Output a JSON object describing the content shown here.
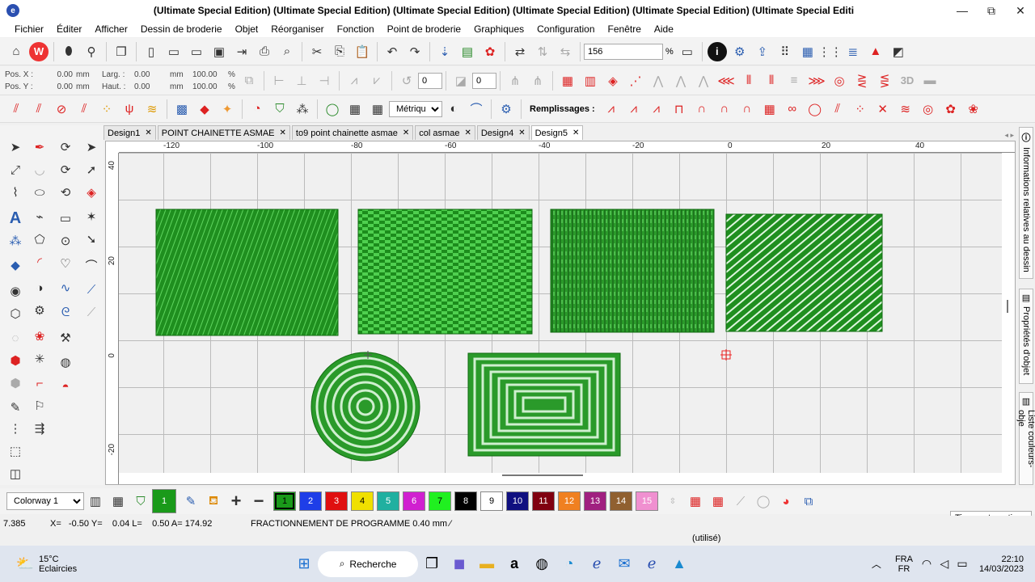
{
  "window": {
    "title": "(Ultimate Special Edition) (Ultimate Special Edition) (Ultimate Special Edition) (Ultimate Special Edition) (Ultimate Special Edition) (Ultimate Special Editi",
    "minimize": "—",
    "restore": "⧉",
    "close": "✕"
  },
  "menu": [
    "Fichier",
    "Éditer",
    "Afficher",
    "Dessin de broderie",
    "Objet",
    "Réorganiser",
    "Fonction",
    "Point de broderie",
    "Graphiques",
    "Configuration",
    "Fenêtre",
    "Aide"
  ],
  "toolbar1": {
    "zoom_value": "156",
    "zoom_unit": "%"
  },
  "toolbar2": {
    "pos_x_label": "Pos. X :",
    "pos_x": "0.00",
    "pos_y_label": "Pos. Y :",
    "pos_y": "0.00",
    "unit": "mm",
    "larg_label": "Larg. :",
    "larg": "0.00",
    "haut_label": "Haut. :",
    "haut": "0.00",
    "pct_w": "100.00",
    "pct_h": "100.00",
    "pct": "%",
    "rotation": "0",
    "slant": "0"
  },
  "toolbar3": {
    "units_select": "Métrique",
    "fills_label": "Remplissages :"
  },
  "tabs": [
    {
      "label": "Design1"
    },
    {
      "label": "POINT CHAINETTE ASMAE"
    },
    {
      "label": "to9 point chainette asmae"
    },
    {
      "label": "col asmae"
    },
    {
      "label": "Design4"
    },
    {
      "label": "Design5",
      "active": true
    }
  ],
  "ruler_h": [
    "-120",
    "-100",
    "-80",
    "-60",
    "-40",
    "-20",
    "0",
    "20",
    "40"
  ],
  "ruler_v": [
    "40",
    "20",
    "0",
    "-20"
  ],
  "right_panel": [
    "Informations relatives au dessin",
    "Propriétés d'objet",
    "Liste couleurs-obje"
  ],
  "palette": {
    "colorway": "Colorway 1",
    "current": "1",
    "swatches": [
      {
        "n": "1",
        "c": "#1a9a1a"
      },
      {
        "n": "2",
        "c": "#1e3ee8"
      },
      {
        "n": "3",
        "c": "#e01010"
      },
      {
        "n": "4",
        "c": "#f0e000"
      },
      {
        "n": "5",
        "c": "#20b0a0"
      },
      {
        "n": "6",
        "c": "#d020d0"
      },
      {
        "n": "7",
        "c": "#20f020"
      },
      {
        "n": "8",
        "c": "#000000"
      },
      {
        "n": "9",
        "c": "#ffffff"
      },
      {
        "n": "10",
        "c": "#101080"
      },
      {
        "n": "11",
        "c": "#800010"
      },
      {
        "n": "12",
        "c": "#f08020"
      },
      {
        "n": "13",
        "c": "#a02080"
      },
      {
        "n": "14",
        "c": "#906030"
      },
      {
        "n": "15",
        "c": "#f090d0"
      }
    ]
  },
  "tooltip": "Tissu automatique",
  "status": {
    "left": "7.385",
    "coords": "X=   -0.50 Y=    0.04 L=    0.50 A= 174.92",
    "message": "FRACTIONNEMENT DE PROGRAMME  0.40 mm ⁄",
    "used": "(utilisé)"
  },
  "taskbar": {
    "weather_temp": "15°C",
    "weather_desc": "Eclaircies",
    "search": "Recherche",
    "lang1": "FRA",
    "lang2": "FR",
    "time": "22:10",
    "date": "14/03/2023"
  }
}
